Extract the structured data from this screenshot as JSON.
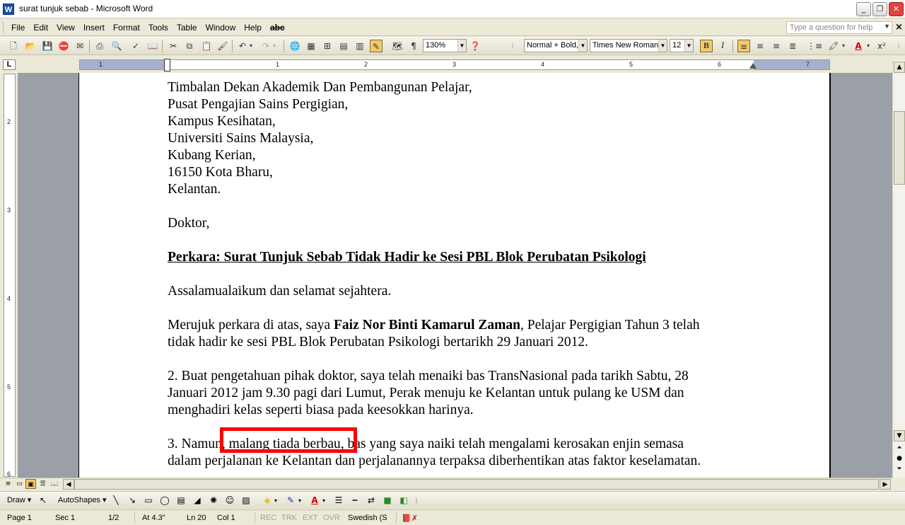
{
  "window": {
    "title": "surat tunjuk sebab - Microsoft Word",
    "app_icon": "W",
    "minimize": "_",
    "maximize": "❐",
    "close": "✕"
  },
  "menubar": {
    "items": [
      {
        "label": "File",
        "key": "F"
      },
      {
        "label": "Edit",
        "key": "E"
      },
      {
        "label": "View",
        "key": "V"
      },
      {
        "label": "Insert",
        "key": "I"
      },
      {
        "label": "Format",
        "key": "o"
      },
      {
        "label": "Tools",
        "key": "T"
      },
      {
        "label": "Table",
        "key": "a"
      },
      {
        "label": "Window",
        "key": "W"
      },
      {
        "label": "Help",
        "key": "H"
      },
      {
        "label": "abc",
        "key": ""
      }
    ],
    "help_placeholder": "Type a question for help",
    "close_doc": "×"
  },
  "toolbar": {
    "zoom": "130%",
    "style": "Normal + Bold,",
    "font": "Times New Roman",
    "size": "12",
    "bold_label": "B",
    "italic_label": "I",
    "pilcrow": "¶",
    "superscript_label": "x²",
    "font_color_label": "A"
  },
  "ruler": {
    "corner": "L",
    "numbers": [
      "1",
      "1",
      "2",
      "3",
      "4",
      "5",
      "6",
      "7"
    ],
    "vertical_numbers": [
      "2",
      "3",
      "4",
      "5",
      "6"
    ]
  },
  "document": {
    "address": [
      "Timbalan Dekan Akademik Dan Pembangunan Pelajar,",
      "Pusat Pengajian Sains Pergigian,",
      "Kampus Kesihatan,",
      "Universiti Sains Malaysia,",
      "Kubang Kerian,",
      "16150 Kota Bharu,",
      "Kelantan."
    ],
    "salutation": "Doktor,",
    "subject": "Perkara: Surat Tunjuk Sebab Tidak Hadir ke Sesi PBL Blok Perubatan Psikologi",
    "greeting": "Assalamualaikum dan selamat sejahtera.",
    "para1_before": "Merujuk perkara di atas, saya ",
    "para1_name": "Faiz Nor Binti Kamarul Zaman",
    "para1_line1_after": ", Pelajar Pergigian Tahun 3 telah",
    "para1_line2": "tidak hadir ke sesi PBL Blok Perubatan Psikologi bertarikh 29 Januari 2012.",
    "para2_lines": [
      "2. Buat pengetahuan pihak doktor, saya telah menaiki bas TransNasional pada tarikh Sabtu, 28",
      "Januari 2012 jam 9.30 pagi dari Lumut, Perak menuju ke Kelantan untuk pulang ke USM dan",
      "menghadiri kelas seperti biasa pada keesokkan harinya."
    ],
    "para3_lines": [
      "3. Namun, malang tiada berbau, bas yang saya naiki telah mengalami kerosakan enjin semasa",
      "dalam perjalanan ke Kelantan dan perjalanannya terpaksa diberhentikan atas faktor keselamatan."
    ]
  },
  "drawbar": {
    "draw_label": "Draw ▾",
    "autoshapes_label": "AutoShapes ▾"
  },
  "statusbar": {
    "page": "Page 1",
    "sec": "Sec 1",
    "pages": "1/2",
    "at": "At 4.3\"",
    "ln": "Ln 20",
    "col": "Col 1",
    "rec": "REC",
    "trk": "TRK",
    "ext": "EXT",
    "ovr": "OVR",
    "language": "Swedish (S"
  }
}
